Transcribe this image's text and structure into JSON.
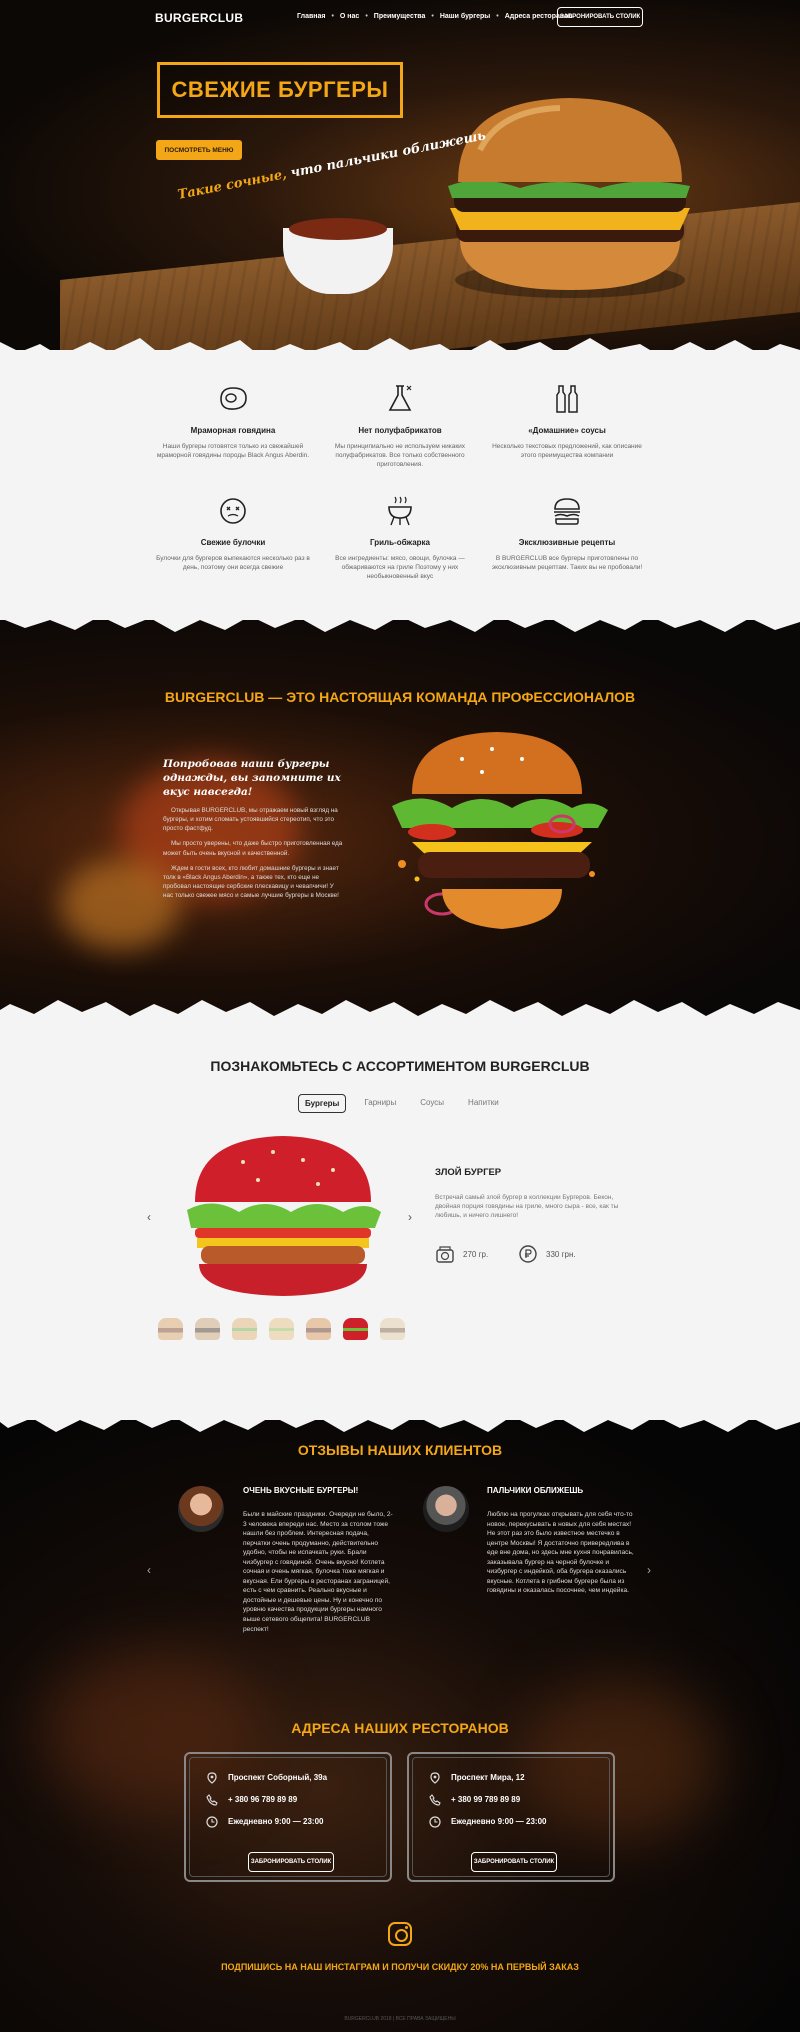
{
  "header": {
    "logo": "BURGERCLUB",
    "menu": [
      "Главная",
      "О нас",
      "Преимущества",
      "Наши бургеры",
      "Адреса ресторанов"
    ],
    "book_button": "ЗАБРОНИРОВАТЬ СТОЛИК"
  },
  "hero": {
    "title": "СВЕЖИЕ БУРГЕРЫ",
    "menu_button": "ПОСМОТРЕТЬ МЕНЮ",
    "tagline_a": "Такие сочные,",
    "tagline_b": "что пальчики оближешь"
  },
  "features": [
    {
      "icon": "steak-icon",
      "title": "Мраморная говядина",
      "text": "Наши бургеры готовятся только из свежайшей мраморной говядины породы Black Angus Aberdin."
    },
    {
      "icon": "flask-icon",
      "title": "Нет полуфабрикатов",
      "text": "Мы принципиально не используем никаких полуфабрикатов. Все только собственного приготовления."
    },
    {
      "icon": "bottles-icon",
      "title": "«Домашние» соусы",
      "text": "Несколько текстовых предложений, как описание этого преимущества компании"
    },
    {
      "icon": "bun-icon",
      "title": "Свежие булочки",
      "text": "Булочки для бургеров выпекаются несколько раз в день, поэтому они всегда свежие"
    },
    {
      "icon": "grill-icon",
      "title": "Гриль-обжарка",
      "text": "Все ингредиенты: мясо, овощи, булочка — обжариваются на гриле Поэтому у них необыкновенный вкус"
    },
    {
      "icon": "burger-icon",
      "title": "Эксклюзивные рецепты",
      "text": "В BURGERCLUB все бургеры приготовлены по эксклюзивным рецептам. Таких вы не пробовали!"
    }
  ],
  "team": {
    "title": "BURGERCLUB — ЭТО НАСТОЯЩАЯ КОМАНДА ПРОФЕССИОНАЛОВ",
    "quote": "Попробовав наши бургеры однажды, вы запомните их вкус навсегда!",
    "paragraphs": [
      "Открывая BURGERCLUB, мы отражаем новый взгляд на бургеры, и хотим сломать устоявшийся стереотип, что это просто фастфуд.",
      "Мы просто уверены, что даже быстро приготовленная еда может быть очень вкусной и качественной.",
      "Ждем в гости всех, кто любит домашние бургеры и знает толк в «Black Angus Aberdin», а также тех, кто еще не пробовал настоящие сербские плескавицу и чевапчичи! У нас только свежее мясо и самые лучшие бургеры в Москве!"
    ]
  },
  "assortment": {
    "title": "ПОЗНАКОМЬТЕСЬ С АССОРТИМЕНТОМ BURGERCLUB",
    "tabs": [
      "Бургеры",
      "Гарниры",
      "Соусы",
      "Напитки"
    ],
    "product": {
      "name": "ЗЛОЙ БУРГЕР",
      "description": "Встречай самый злой бургер в коллекции Бургеров. Бекон, двойная порция говядины на гриле, много сыра - все, как ты любишь, и ничего лишнего!",
      "weight": "270 гр.",
      "price": "330 грн."
    },
    "prev": "‹",
    "next": "›"
  },
  "reviews": {
    "title": "ОТЗЫВЫ НАШИХ КЛИЕНТОВ",
    "items": [
      {
        "title": "ОЧЕНЬ ВКУСНЫЕ БУРГЕРЫ!",
        "text": "Были в майские праздники. Очереди не было, 2-3 человека впереди нас. Место за столом тоже нашли без проблем. Интересная подача, перчатки очень продуманно, действительно удобно, чтобы не испачкать руки. Брали чизбургер с говядиной. Очень вкусно! Котлета сочная и очень мягкая, булочка тоже мягкая и вкусная. Ели бургеры в ресторанах заграницей, есть с чем сравнить. Реально вкусные и достойные и дешевые цены. Ну и конечно по уровню качества продукции бургеры намного выше сетевого общепита! BURGERCLUB респект!"
      },
      {
        "title": "ПАЛЬЧИКИ ОБЛИЖЕШЬ",
        "text": "Люблю на прогулках открывать для себя что-то новое, перекусывать в новых для себя местах! Не этот раз это было известное местечко в центре Москвы! Я достаточно привередлива в еде вне дома, но здесь мне кухня понравилась, заказывала бургер на черной булочке и чизбургер с индейкой, оба бургера оказались вкусные. Котлета в грибном бургере была из говядины и оказалась посочнее, чем индейка."
      }
    ]
  },
  "addresses": {
    "title": "АДРЕСА НАШИХ РЕСТОРАНОВ",
    "items": [
      {
        "address": "Проспект Соборный, 39а",
        "phone": "+ 380 96 789 89 89",
        "hours": "Ежедневно 9:00 — 23:00",
        "button": "ЗАБРОНИРОВАТЬ СТОЛИК"
      },
      {
        "address": "Проспект Мира, 12",
        "phone": "+ 380 99 789 89 89",
        "hours": "Ежедневно 9:00 — 23:00",
        "button": "ЗАБРОНИРОВАТЬ СТОЛИК"
      }
    ]
  },
  "instagram": {
    "text": "ПОДПИШИСЬ НА НАШ ИНСТАГРАМ И ПОЛУЧИ СКИДКУ 20% НА ПЕРВЫЙ ЗАКАЗ"
  },
  "footer": {
    "text": "BURGERCLUB 2018  |  ВСЕ ПРАВА ЗАЩИЩЕНЫ"
  },
  "colors": {
    "accent": "#f3a716",
    "dark": "#0c0805",
    "light": "#f4f4f4"
  }
}
